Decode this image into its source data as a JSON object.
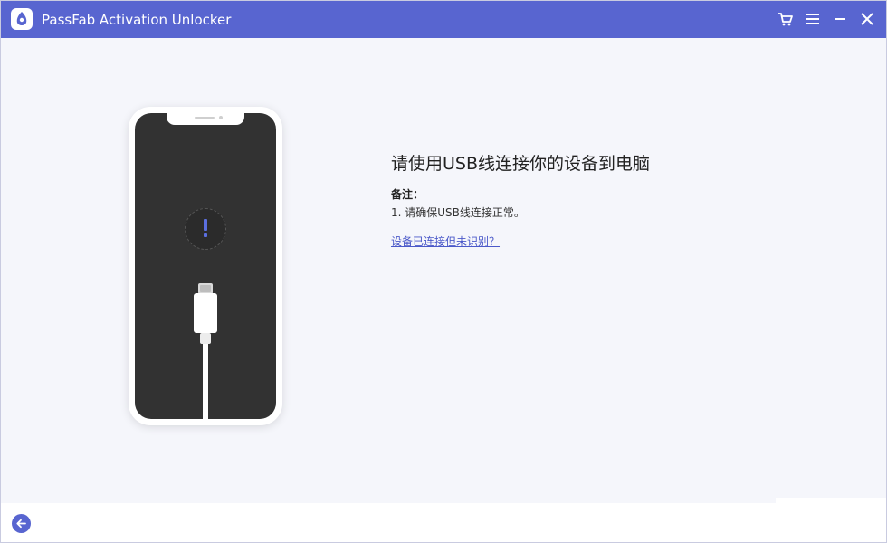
{
  "window": {
    "title": "PassFab Activation Unlocker"
  },
  "toolbar": {
    "icons": [
      "cart-icon",
      "menu-icon",
      "minimize-icon",
      "close-icon"
    ]
  },
  "main": {
    "headline": "请使用USB线连接你的设备到电脑",
    "note_title": "备注：",
    "note_items": [
      "1. 请确保USB线连接正常。"
    ],
    "help_link": "设备已连接但未识别？"
  },
  "footer": {
    "back_icon": "arrow-left-icon"
  },
  "colors": {
    "accent": "#5865d0",
    "background": "#f5f6fb",
    "phone_screen": "#323232",
    "link": "#4b59c9"
  }
}
